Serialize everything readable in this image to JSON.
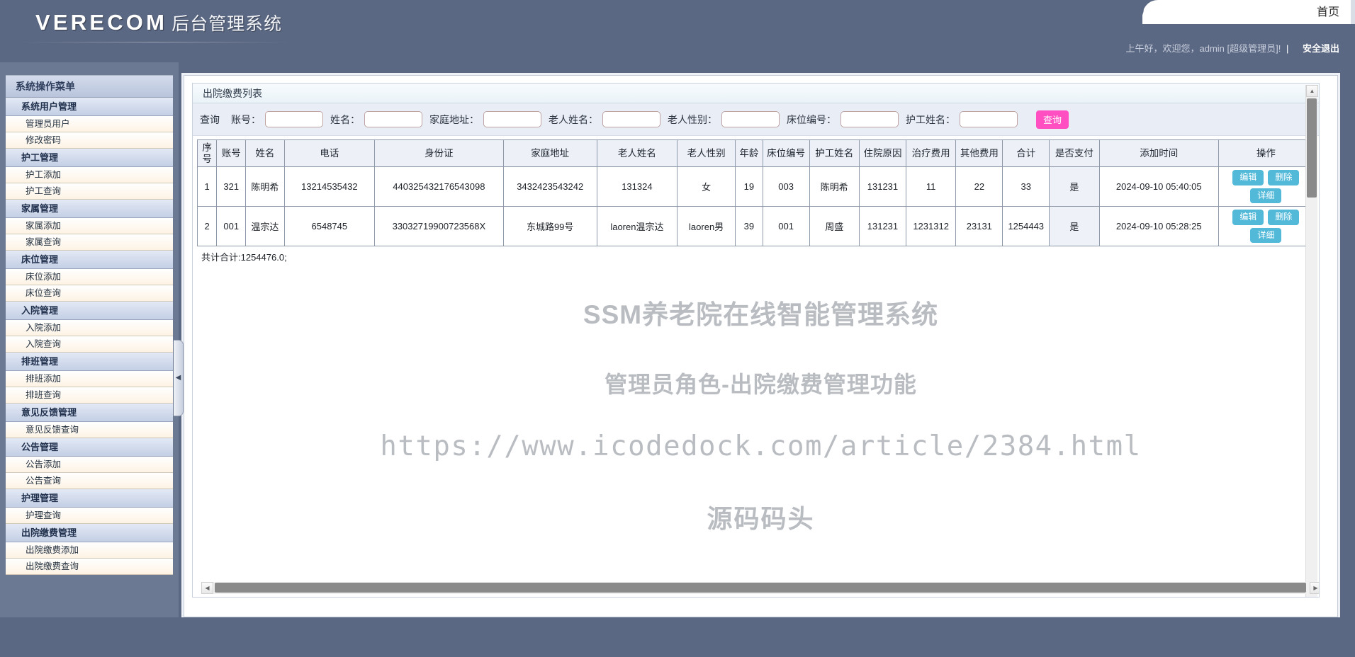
{
  "header": {
    "logo_en": "VERECOM",
    "logo_cn": "后台管理系统",
    "topnav": [
      {
        "label": "首页"
      }
    ],
    "welcome_text": "上午好，欢迎您，admin [超级管理员]!",
    "bar": "|",
    "logout_label": "安全退出"
  },
  "sidebar": {
    "title": "系统操作菜单",
    "collapse_icon": "chevron-left-icon",
    "entries": [
      {
        "type": "group",
        "label": "系统用户管理"
      },
      {
        "type": "item",
        "label": "管理员用户"
      },
      {
        "type": "item",
        "label": "修改密码"
      },
      {
        "type": "group",
        "label": "护工管理"
      },
      {
        "type": "item",
        "label": "护工添加"
      },
      {
        "type": "item",
        "label": "护工查询"
      },
      {
        "type": "group",
        "label": "家属管理"
      },
      {
        "type": "item",
        "label": "家属添加"
      },
      {
        "type": "item",
        "label": "家属查询"
      },
      {
        "type": "group",
        "label": "床位管理"
      },
      {
        "type": "item",
        "label": "床位添加"
      },
      {
        "type": "item",
        "label": "床位查询"
      },
      {
        "type": "group",
        "label": "入院管理"
      },
      {
        "type": "item",
        "label": "入院添加"
      },
      {
        "type": "item",
        "label": "入院查询"
      },
      {
        "type": "group",
        "label": "排班管理"
      },
      {
        "type": "item",
        "label": "排班添加"
      },
      {
        "type": "item",
        "label": "排班查询"
      },
      {
        "type": "group",
        "label": "意见反馈管理"
      },
      {
        "type": "item",
        "label": "意见反馈查询"
      },
      {
        "type": "group",
        "label": "公告管理"
      },
      {
        "type": "item",
        "label": "公告添加"
      },
      {
        "type": "item",
        "label": "公告查询"
      },
      {
        "type": "group",
        "label": "护理管理"
      },
      {
        "type": "item",
        "label": "护理查询"
      },
      {
        "type": "group",
        "label": "出院缴费管理",
        "active": true
      },
      {
        "type": "item",
        "label": "出院缴费添加"
      },
      {
        "type": "item",
        "label": "出院缴费查询"
      }
    ]
  },
  "panel": {
    "title": "出院缴费列表",
    "query": {
      "prefix_label": "查询",
      "fields": [
        {
          "label": "账号：",
          "value": "",
          "placeholder": ""
        },
        {
          "label": "姓名：",
          "value": "",
          "placeholder": ""
        },
        {
          "label": "家庭地址：",
          "value": "",
          "placeholder": ""
        },
        {
          "label": "老人姓名：",
          "value": "",
          "placeholder": ""
        },
        {
          "label": "老人性别：",
          "value": "",
          "placeholder": ""
        },
        {
          "label": "床位编号：",
          "value": "",
          "placeholder": ""
        },
        {
          "label": "护工姓名：",
          "value": "",
          "placeholder": ""
        }
      ],
      "submit_label": "查询",
      "submit_color": "#ff4fc0"
    },
    "table": {
      "columns": [
        "序号",
        "账号",
        "姓名",
        "电话",
        "身份证",
        "家庭地址",
        "老人姓名",
        "老人性别",
        "年龄",
        "床位编号",
        "护工姓名",
        "住院原因",
        "治疗费用",
        "其他费用",
        "合计",
        "是否支付",
        "添加时间",
        "操作"
      ],
      "rows": [
        {
          "seq": "1",
          "account": "321",
          "name": "陈明希",
          "phone": "13214535432",
          "id_card": "440325432176543098",
          "address": "3432423543242",
          "elder_name": "131324",
          "elder_gender": "女",
          "age": "19",
          "bed_no": "003",
          "nurse_name": "陈明希",
          "reason": "131231",
          "treat_fee": "11",
          "other_fee": "22",
          "total": "33",
          "paid": "是",
          "added_at": "2024-09-10 05:40:05",
          "ops": [
            "编辑",
            "删除",
            "详细"
          ]
        },
        {
          "seq": "2",
          "account": "001",
          "name": "温宗达",
          "phone": "6548745",
          "id_card": "33032719900723568X",
          "address": "东城路99号",
          "elder_name": "laoren温宗达",
          "elder_gender": "laoren男",
          "age": "39",
          "bed_no": "001",
          "nurse_name": "周盛",
          "reason": "131231",
          "treat_fee": "1231312",
          "other_fee": "23131",
          "total": "1254443",
          "paid": "是",
          "added_at": "2024-09-10 05:28:25",
          "ops": [
            "编辑",
            "删除",
            "详细"
          ]
        }
      ],
      "summary": "共计合计:1254476.0;",
      "op_button_color": "#52b9d8"
    }
  },
  "watermark": {
    "line1": "SSM养老院在线智能管理系统",
    "line2": "管理员角色-出院缴费管理功能",
    "line3": "https://www.icodedock.com/article/2384.html",
    "line4": "源码码头"
  },
  "scrollbars": {
    "up_arrow": "triangle-up-icon",
    "down_arrow": "triangle-down-icon",
    "left_arrow": "triangle-left-icon",
    "right_arrow": "triangle-right-icon"
  }
}
